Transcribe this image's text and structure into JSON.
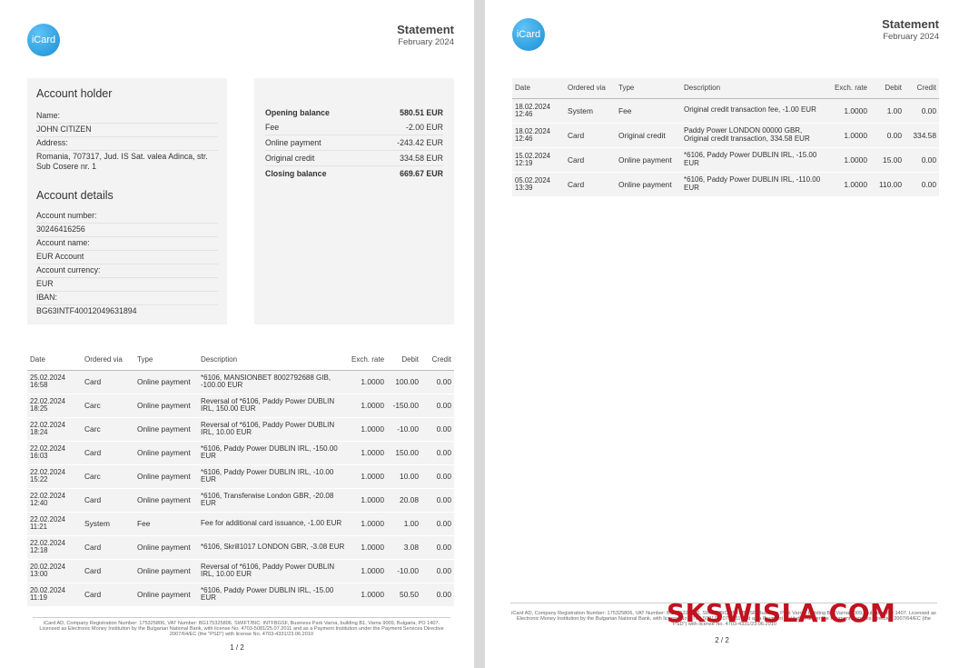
{
  "brand": {
    "logo_text": "iCard",
    "logo_color": "#1b8fd6"
  },
  "header": {
    "title": "Statement",
    "period": "February 2024"
  },
  "account_holder": {
    "title": "Account holder",
    "fields": [
      {
        "label": "Name:",
        "value": "JOHN CITIZEN"
      },
      {
        "label": "Address:",
        "value": "Romania, 707317, Jud. IS Sat. valea Adinca, str. Sub Cosere nr. 1"
      }
    ]
  },
  "account_details": {
    "title": "Account details",
    "fields": [
      {
        "label": "Account number:",
        "value": "30246416256"
      },
      {
        "label": "Account name:",
        "value": "EUR Account"
      },
      {
        "label": "Account currency:",
        "value": "EUR"
      },
      {
        "label": "IBAN:",
        "value": "BG63INTF40012049631894"
      }
    ]
  },
  "balances": [
    {
      "label": "Opening balance",
      "value": "580.51  EUR",
      "bold": true
    },
    {
      "label": "Fee",
      "value": "-2.00  EUR",
      "bold": false
    },
    {
      "label": "Online payment",
      "value": "-243.42  EUR",
      "bold": false
    },
    {
      "label": "Original credit",
      "value": "334.58  EUR",
      "bold": false
    },
    {
      "label": "Closing balance",
      "value": "669.67  EUR",
      "bold": true
    }
  ],
  "table_headers": [
    "Date",
    "Ordered via",
    "Type",
    "Description",
    "Exch. rate",
    "Debit",
    "Credit"
  ],
  "page1_rows": [
    {
      "date": "25.02.2024 16:58",
      "via": "Card",
      "type": "Online payment",
      "desc": "*6106, MANSIONBET 8002792688 GIB, -100.00 EUR",
      "rate": "1.0000",
      "debit": "100.00",
      "credit": "0.00"
    },
    {
      "date": "22.02.2024 18:25",
      "via": "Carc",
      "type": "Online payment",
      "desc": "Reversal of *6106, Paddy Power DUBLIN IRL, 150.00 EUR",
      "rate": "1.0000",
      "debit": "-150.00",
      "credit": "0.00"
    },
    {
      "date": "22.02.2024 18:24",
      "via": "Carc",
      "type": "Online payment",
      "desc": "Reversal of *6106, Paddy Power DUBLIN IRL, 10.00 EUR",
      "rate": "1.0000",
      "debit": "-10.00",
      "credit": "0.00"
    },
    {
      "date": "22.02.2024 16:03",
      "via": "Card",
      "type": "Online payment",
      "desc": "*6106, Paddy Power DUBLIN IRL, -150.00 EUR",
      "rate": "1.0000",
      "debit": "150.00",
      "credit": "0.00"
    },
    {
      "date": "22.02.2024 15:22",
      "via": "Carc",
      "type": "Online payment",
      "desc": "*6106, Paddy Power DUBLIN IRL, -10.00 EUR",
      "rate": "1.0000",
      "debit": "10.00",
      "credit": "0.00"
    },
    {
      "date": "22.02.2024 12:40",
      "via": "Card",
      "type": "Online payment",
      "desc": "*6106, Transferwise London GBR, -20.08 EUR",
      "rate": "1.0000",
      "debit": "20.08",
      "credit": "0.00"
    },
    {
      "date": "22.02.2024 11:21",
      "via": "System",
      "type": "Fee",
      "desc": "Fee for additional card issuance, -1.00 EUR",
      "rate": "1.0000",
      "debit": "1.00",
      "credit": "0.00"
    },
    {
      "date": "22.02.2024 12:18",
      "via": "Card",
      "type": "Online payment",
      "desc": "*6106, Skrill1017 LONDON GBR, -3.08 EUR",
      "rate": "1.0000",
      "debit": "3.08",
      "credit": "0.00"
    },
    {
      "date": "20.02.2024 13:00",
      "via": "Card",
      "type": "Online payment",
      "desc": "Reversal of *6106, Paddy Power DUBLIN IRL, 10.00 EUR",
      "rate": "1.0000",
      "debit": "-10.00",
      "credit": "0.00"
    },
    {
      "date": "20.02.2024 11:19",
      "via": "Card",
      "type": "Online payment",
      "desc": "*6106, Paddy Power DUBLIN IRL, -15.00 EUR",
      "rate": "1.0000",
      "debit": "50.50",
      "credit": "0.00"
    }
  ],
  "page2_rows": [
    {
      "date": "18.02.2024 12:46",
      "via": "System",
      "type": "Fee",
      "desc": "Original credit transaction fee, -1.00 EUR",
      "rate": "1.0000",
      "debit": "1.00",
      "credit": "0.00"
    },
    {
      "date": "18.02.2024 12:46",
      "via": "Card",
      "type": "Original credit",
      "desc": "Paddy Power LONDON 00000 GBR, Original credit transaction, 334.58 EUR",
      "rate": "1.0000",
      "debit": "0.00",
      "credit": "334.58"
    },
    {
      "date": "15.02.2024 12:19",
      "via": "Card",
      "type": "Online payment",
      "desc": "*6106, Paddy Power DUBLIN IRL, -15.00 EUR",
      "rate": "1.0000",
      "debit": "15.00",
      "credit": "0.00"
    },
    {
      "date": "05.02.2024 13:39",
      "via": "Card",
      "type": "Online payment",
      "desc": "*6106, Paddy Power DUBLIN IRL, -110.00 EUR",
      "rate": "1.0000",
      "debit": "110.00",
      "credit": "0.00"
    }
  ],
  "footer": {
    "text": "iCard AD, Company Registration Number: 175325806, VAT Number: BG175325806, SWIFT/BIC: INTFBGSF, Business Park Varna, building B1, Varna 9009, Bulgaria, PO 1407. Licensed as Electronic Money Institution by the Bulgarian National Bank, with license No. 4703-5081/25.07.2011 and as a Payment Institution under the Payment Services Directive 2007/64/EC (the \"PSD\") with license No. 4703-4331/23.06.2010",
    "page1": "1 / 2",
    "page2": "2 / 2"
  },
  "watermark": {
    "text": "SKSWISLA.COM",
    "color": "#c1121f"
  }
}
